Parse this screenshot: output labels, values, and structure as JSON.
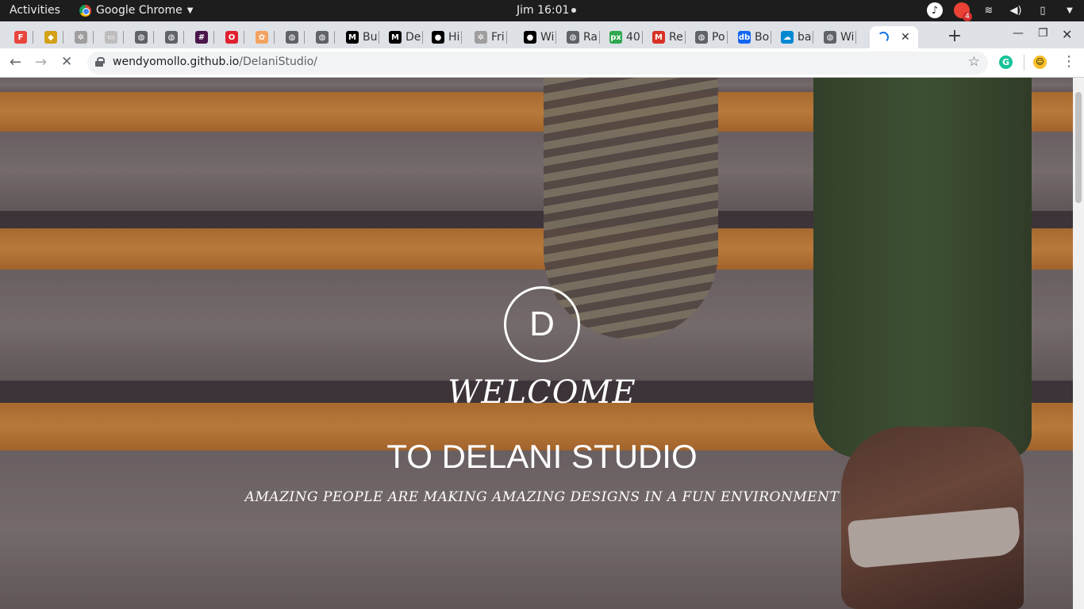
{
  "system_bar": {
    "activities": "Activities",
    "app_name": "Google Chrome",
    "clock": "Jim 16:01",
    "notification_badge": "4"
  },
  "tabs": [
    {
      "label": "",
      "icon": "fab-icon",
      "color": "#e8453c"
    },
    {
      "label": "",
      "icon": "shield-icon",
      "color": "#d4a017"
    },
    {
      "label": "",
      "icon": "palm-icon",
      "color": "#9e9e9e"
    },
    {
      "label": "",
      "icon": "doc-icon",
      "color": "#bdbdbd"
    },
    {
      "label": "",
      "icon": "globe-icon",
      "color": "#5f6368"
    },
    {
      "label": "",
      "icon": "globe-icon",
      "color": "#5f6368"
    },
    {
      "label": "",
      "icon": "slack-icon",
      "color": "#4a154b"
    },
    {
      "label": "",
      "icon": "opera-icon",
      "color": "#e0202f"
    },
    {
      "label": "",
      "icon": "brain-icon",
      "color": "#f4a261"
    },
    {
      "label": "",
      "icon": "globe-icon",
      "color": "#5f6368"
    },
    {
      "label": "",
      "icon": "globe-icon",
      "color": "#5f6368"
    },
    {
      "label": "Bu",
      "icon": "medium-icon",
      "color": "#000000"
    },
    {
      "label": "De",
      "icon": "medium-icon",
      "color": "#000000"
    },
    {
      "label": "Hi",
      "icon": "github-icon",
      "color": "#000000"
    },
    {
      "label": "Fri",
      "icon": "palm-icon",
      "color": "#9e9e9e"
    },
    {
      "label": "Wi",
      "icon": "github-icon",
      "color": "#000000"
    },
    {
      "label": "Ra",
      "icon": "globe-icon",
      "color": "#5f6368"
    },
    {
      "label": "40",
      "icon": "px-icon",
      "color": "#2fa84f"
    },
    {
      "label": "Re",
      "icon": "gmail-icon",
      "color": "#d93025"
    },
    {
      "label": "Po",
      "icon": "globe-icon",
      "color": "#5f6368"
    },
    {
      "label": "Bo",
      "icon": "mdb-icon",
      "color": "#1266f1"
    },
    {
      "label": "ba",
      "icon": "cloud-icon",
      "color": "#0288d1"
    },
    {
      "label": "Wi",
      "icon": "globe-icon",
      "color": "#5f6368"
    }
  ],
  "active_tab": {
    "loading": true
  },
  "address_bar": {
    "host": "wendyomollo.github.io",
    "path": "/DelaniStudio/"
  },
  "hero": {
    "logo_letter": "D",
    "welcome": "WELCOME",
    "title": "TO DELANI STUDIO",
    "tagline": "AMAZING PEOPLE ARE MAKING AMAZING DESIGNS IN A FUN ENVIRONMENT"
  }
}
